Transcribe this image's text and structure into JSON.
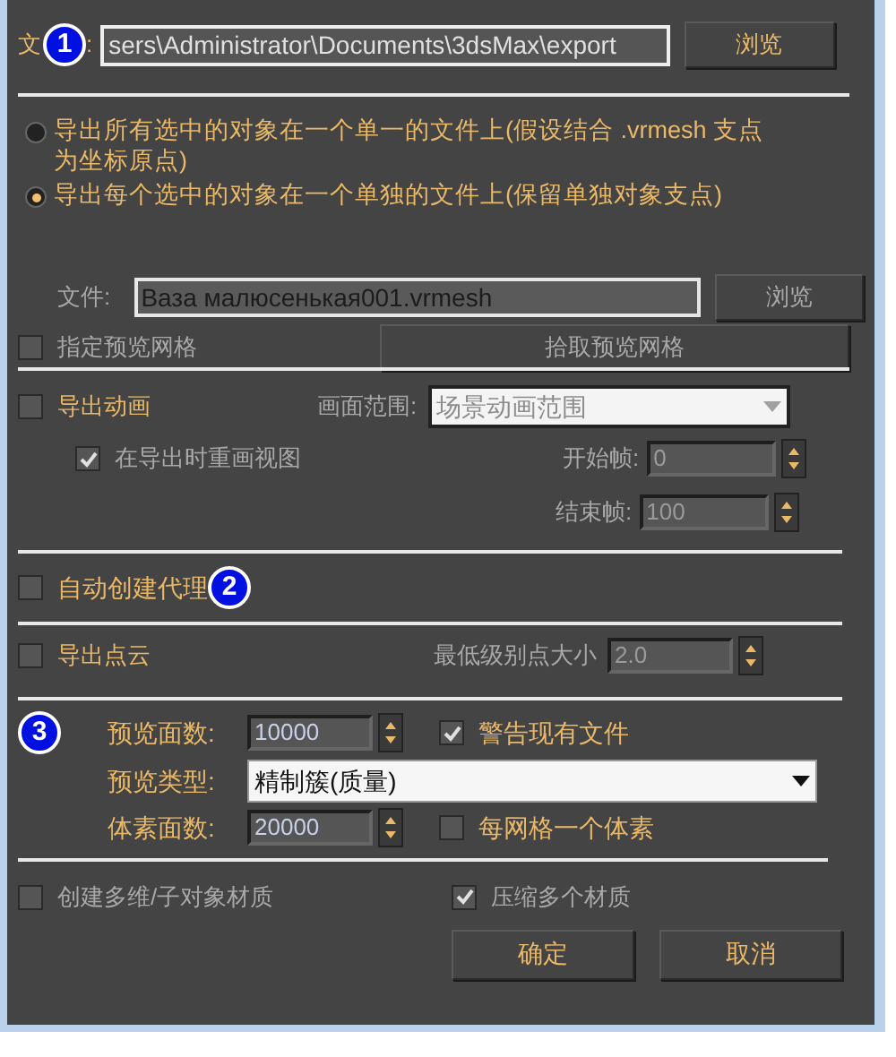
{
  "file_row": {
    "label_start": "文",
    "badge": "1",
    "label_end": ":",
    "value": "sers\\Administrator\\Documents\\3dsMax\\export",
    "button": "浏览"
  },
  "export_modes": [
    {
      "label": "导出所有选中的对象在一个单一的文件上(假设结合 .vrmesh 支点为坐标原点)",
      "selected": false
    },
    {
      "label": "导出每个选中的对象在一个单独的文件上(保留单独对象支点)",
      "selected": true
    }
  ],
  "file2": {
    "label": "文件:",
    "value": "Ваза малюсенькая001.vrmesh",
    "button": "浏览",
    "disabled": true
  },
  "preview_mesh": {
    "label": "指定预览网格",
    "checked": false,
    "disabled": true,
    "button": "拾取预览网格"
  },
  "animation": {
    "label": "导出动画",
    "checked": false,
    "range_label": "画面范围:",
    "range_value": "场景动画范围",
    "redraw_label": "在导出时重画视图",
    "redraw_checked": true,
    "start_label": "开始帧:",
    "start_value": "0",
    "end_label": "结束帧:",
    "end_value": "100",
    "disabled": true
  },
  "auto_proxy": {
    "label": "自动创建代理",
    "checked": false,
    "badge": "2"
  },
  "point_cloud": {
    "label": "导出点云",
    "checked": false,
    "size_label": "最低级别点大小",
    "size_value": "2.0"
  },
  "preview": {
    "badge": "3",
    "faces_label": "预览面数:",
    "faces_value": "10000",
    "warn_label": "警告现有文件",
    "warn_checked": true,
    "type_label": "预览类型:",
    "type_value": "精制簇(质量)",
    "voxel_label": "体素面数:",
    "voxel_value": "20000",
    "one_voxel_label": "每网格一个体素",
    "one_voxel_checked": false
  },
  "materials": [
    {
      "label": "创建多维/子对象材质",
      "checked": false,
      "disabled": true
    },
    {
      "label": "压缩多个材质",
      "checked": true,
      "disabled": true
    }
  ],
  "buttons": [
    "确定",
    "取消"
  ]
}
